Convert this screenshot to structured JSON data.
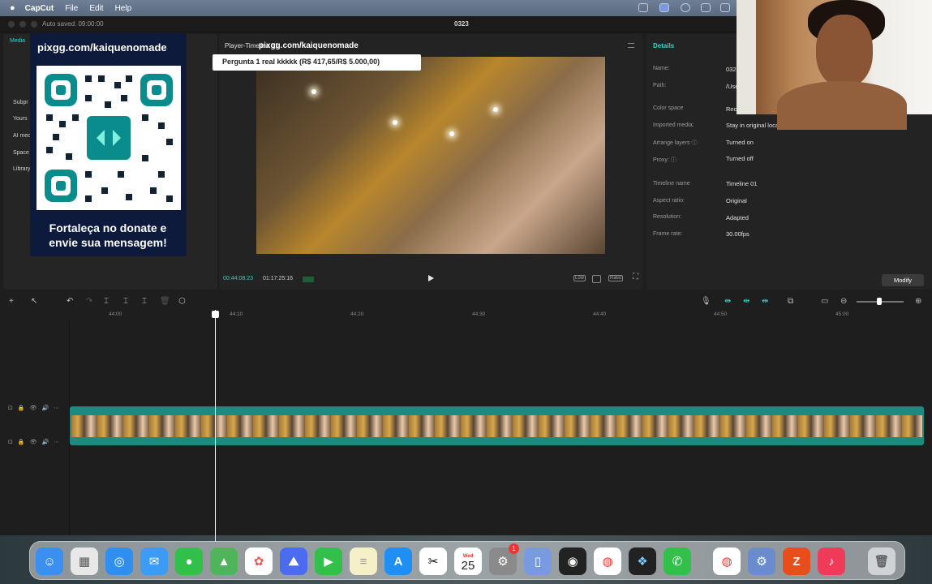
{
  "menubar": {
    "apple": "",
    "app": "CapCut",
    "items": [
      "File",
      "Edit",
      "Help"
    ]
  },
  "window": {
    "autosave": "Auto saved: 09:00:00",
    "project": "0323"
  },
  "sidebar": {
    "items": [
      "Media",
      "Subpr",
      "Yours",
      "AI med",
      "Space",
      "Library"
    ]
  },
  "overlay": {
    "url": "pixgg.com/kaiquenomade",
    "message": "Fortaleça no donate e envie sua mensagem!"
  },
  "player": {
    "title": "Player-Timeline 01",
    "url": "pixgg.com/kaiquenomade",
    "question": "Pergunta 1 real kkkkk (R$ 417,65/R$ 5.000,00)",
    "current_time": "00:44:08:23",
    "total_time": "01:17:25:16",
    "low_label": "Low",
    "ratio_label": "Ratio"
  },
  "details": {
    "title": "Details",
    "rows": [
      {
        "k": "Name:",
        "v": "032"
      },
      {
        "k": "Path:",
        "v": "/Use"
      },
      {
        "k": "Color space",
        "v": "Rec"
      },
      {
        "k": "Imported media:",
        "v": "Stay in original location"
      },
      {
        "k": "Arrange layers ⓘ",
        "v": "Turned on"
      },
      {
        "k": "Proxy: ⓘ",
        "v": "Turned off"
      },
      {
        "k": "Timeline name",
        "v": "Timeline 01"
      },
      {
        "k": "Aspect ratio:",
        "v": "Original"
      },
      {
        "k": "Resolution:",
        "v": "Adapted"
      },
      {
        "k": "Frame rate:",
        "v": "30.00fps"
      }
    ],
    "modify": "Modify"
  },
  "ruler": [
    "44:00",
    "44:10",
    "44:20",
    "44:30",
    "44:40",
    "44:50",
    "45:00"
  ],
  "dock": {
    "calendar_month": "Wed",
    "calendar_day": "25",
    "settings_badge": "1"
  }
}
